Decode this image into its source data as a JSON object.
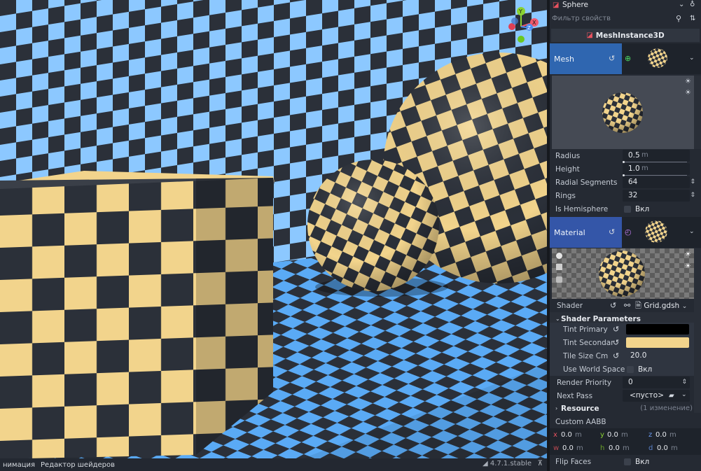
{
  "viewport": {
    "gizmo": {
      "y_label": "Y",
      "x_label": "X",
      "z_label": "Z"
    },
    "colors": {
      "sky": "#5aaaf5",
      "light_blue": "#8cc8ff",
      "dark": "#2b3039",
      "cream": "#f2d48c"
    }
  },
  "bottom_bar": {
    "tab_animation": "нимация",
    "tab_shader_editor": "Редактор шейдеров",
    "version": "4.7.1.stable"
  },
  "inspector": {
    "node_name": "Sphere",
    "filter_placeholder": "Фильтр свойств",
    "class_name": "MeshInstance3D",
    "mesh": {
      "label": "Mesh",
      "radius_label": "Radius",
      "radius_value": "0.5",
      "radius_unit": "m",
      "height_label": "Height",
      "height_value": "1.0",
      "height_unit": "m",
      "radial_segments_label": "Radial Segments",
      "radial_segments_value": "64",
      "rings_label": "Rings",
      "rings_value": "32",
      "is_hemisphere_label": "Is Hemisphere",
      "is_hemisphere_value": "Вкл"
    },
    "material": {
      "label": "Material",
      "shader_label": "Shader",
      "shader_file": "Grid.gdsh",
      "shader_params_label": "Shader Parameters",
      "tint_primary_label": "Tint Primary",
      "tint_primary_color": "#000000",
      "tint_secondary_label": "Tint Secondar",
      "tint_secondary_color": "#f2d48c",
      "tile_size_label": "Tile Size Cm",
      "tile_size_value": "20.0",
      "use_world_space_label": "Use World Space",
      "use_world_space_value": "Вкл",
      "render_priority_label": "Render Priority",
      "render_priority_value": "0",
      "next_pass_label": "Next Pass",
      "next_pass_value": "<пусто>",
      "resource_label": "Resource",
      "resource_changes": "(1 изменение)"
    },
    "custom_aabb": {
      "label": "Custom AABB",
      "x_label": "x",
      "x_value": "0.0",
      "x_unit": "m",
      "y_label": "y",
      "y_value": "0.0",
      "y_unit": "m",
      "z_label": "z",
      "z_value": "0.0",
      "z_unit": "m",
      "w_label": "w",
      "w_value": "0.0",
      "w_unit": "m",
      "h_label": "h",
      "h_value": "0.0",
      "h_unit": "m",
      "d_label": "d",
      "d_value": "0.0",
      "d_unit": "m"
    },
    "flip_faces": {
      "label": "Flip Faces",
      "value": "Вкл"
    }
  }
}
